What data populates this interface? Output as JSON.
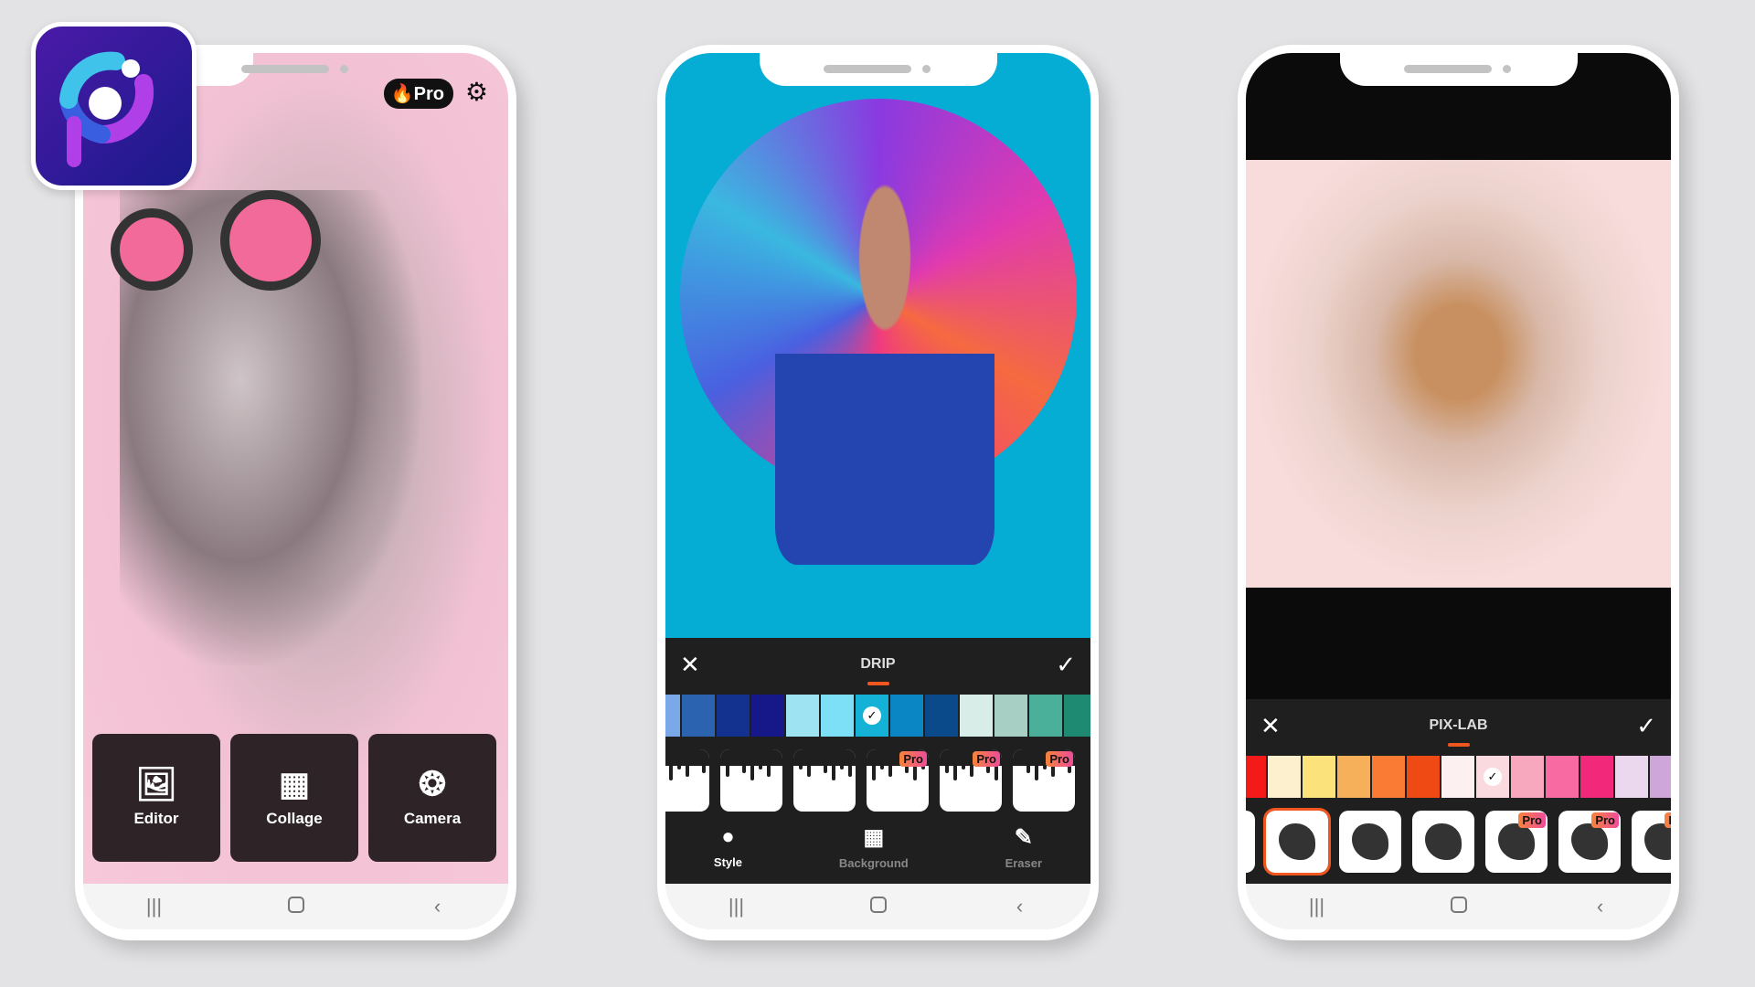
{
  "app_icon": {
    "name": "app-logo",
    "colors": [
      "#4a1aa8",
      "#3fc3ea",
      "#3a5ee0",
      "#b13fe8"
    ]
  },
  "phones": [
    {
      "header": {
        "pro_label": "Pro",
        "fire_icon": "fire-icon",
        "settings_icon": "gear-icon"
      },
      "buttons": [
        {
          "label": "Editor",
          "icon": "image-icon"
        },
        {
          "label": "Collage",
          "icon": "collage-grid-icon"
        },
        {
          "label": "Camera",
          "icon": "camera-aperture-icon"
        }
      ]
    },
    {
      "panel": {
        "title": "DRIP",
        "close_icon": "close-icon",
        "confirm_icon": "check-icon",
        "swatches": [
          "#7aa8e8",
          "#2b63b0",
          "#13318f",
          "#16188a",
          "#9ee3f2",
          "#7ee0f7",
          "#14b2d6",
          "#0a86c4",
          "#0a4a8a",
          "#d8ece8",
          "#a8cfc4",
          "#4ab09a",
          "#1e8a72"
        ],
        "selected_swatch": 6,
        "styles": [
          {
            "pro": false
          },
          {
            "pro": false
          },
          {
            "pro": false
          },
          {
            "pro": true
          },
          {
            "pro": true
          },
          {
            "pro": true
          }
        ],
        "pro_label": "Pro",
        "tools": [
          {
            "label": "Style",
            "icon": "drip-icon"
          },
          {
            "label": "Background",
            "icon": "background-pattern-icon"
          },
          {
            "label": "Eraser",
            "icon": "eraser-icon"
          }
        ]
      }
    },
    {
      "panel": {
        "title": "PIX-LAB",
        "close_icon": "close-icon",
        "confirm_icon": "check-icon",
        "swatches": [
          "#f51a1a",
          "#fdf0cf",
          "#fbe27a",
          "#f6b05a",
          "#fa7c34",
          "#ef4a14",
          "#fdf0f0",
          "#fadadf",
          "#f8a8be",
          "#f86aa2",
          "#f2287a",
          "#ebd8ee",
          "#cfa6da"
        ],
        "selected_swatch": 7,
        "styles": [
          {
            "pro": false
          },
          {
            "pro": false,
            "selected": true
          },
          {
            "pro": false
          },
          {
            "pro": false
          },
          {
            "pro": true
          },
          {
            "pro": true
          },
          {
            "pro": true
          }
        ],
        "pro_label": "Pro"
      }
    }
  ],
  "accent": "#f0561e"
}
